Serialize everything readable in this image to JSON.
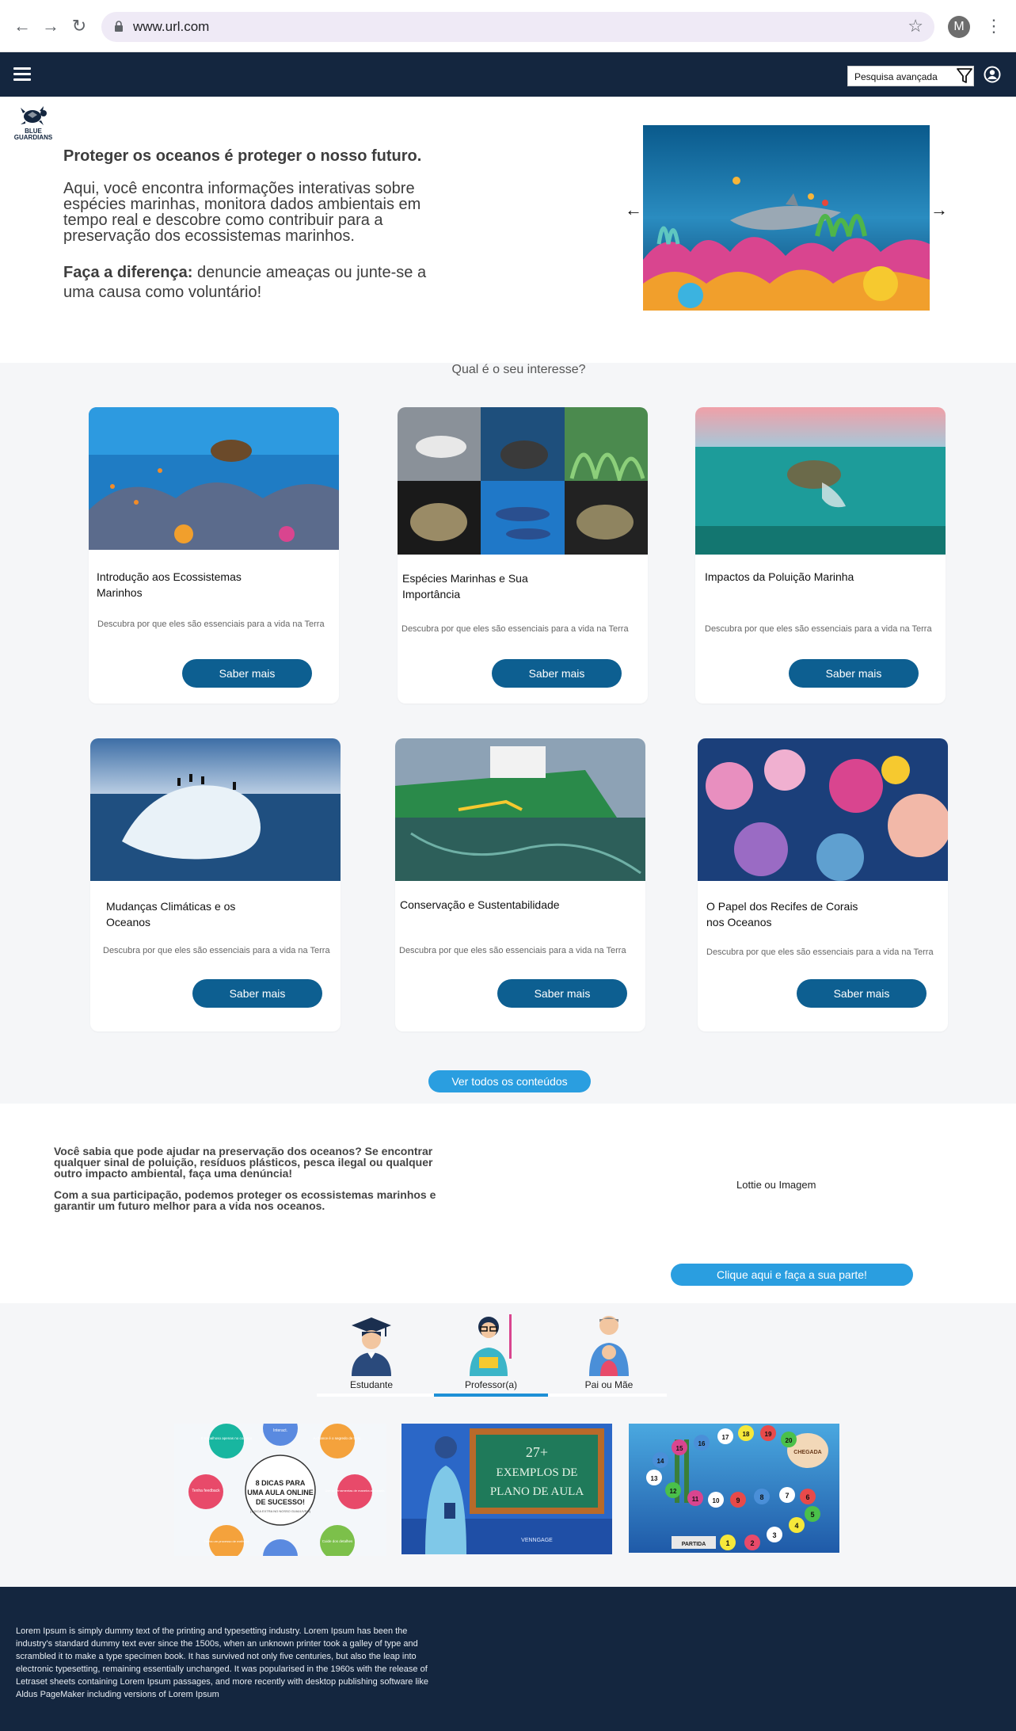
{
  "browser": {
    "url": "www.url.com",
    "avatar_letter": "M"
  },
  "navbar": {
    "search_label": "Pesquisa avançada"
  },
  "hero": {
    "logo_text_1": "BLUE",
    "logo_text_2": "GUARDIANS",
    "title": "Proteger os oceanos é proteger o nosso futuro.",
    "text": "Aqui, você encontra informações interativas sobre espécies marinhas, monitora dados ambientais em tempo real e descobre como contribuir para a preservação dos ecossistemas marinhos.",
    "cta_bold": "Faça a diferença:",
    "cta_text": " denuncie ameaças ou junte-se a uma causa como voluntário!",
    "prev_arrow": "←",
    "next_arrow": "→"
  },
  "interests": {
    "heading": "Qual é o seu interesse?",
    "cards": [
      {
        "title": "Introdução aos Ecossistemas Marinhos",
        "desc": "Descubra por que eles são essenciais para a vida na Terra",
        "button": "Saber mais"
      },
      {
        "title": "Espécies Marinhas e Sua Importância",
        "desc": "Descubra por que eles são essenciais para a vida na Terra",
        "button": "Saber mais"
      },
      {
        "title": "Impactos da Poluição Marinha",
        "desc": "Descubra por que eles são essenciais para a vida na Terra",
        "button": "Saber mais"
      },
      {
        "title": "Mudanças Climáticas e os Oceanos",
        "desc": "Descubra por que eles são essenciais para a vida na Terra",
        "button": "Saber mais"
      },
      {
        "title": "Conservação e Sustentabilidade",
        "desc": "Descubra por que eles são essenciais para a vida na Terra",
        "button": "Saber mais"
      },
      {
        "title": "O Papel dos Recifes de Corais nos Oceanos",
        "desc": "Descubra por que eles são essenciais para a vida na Terra",
        "button": "Saber mais"
      }
    ],
    "see_all": "Ver todos os conteúdos"
  },
  "help": {
    "paragraph_1": "Você sabia que pode ajudar na preservação dos oceanos? Se encontrar qualquer sinal de poluição, resíduos plásticos, pesca ilegal ou qualquer outro impacto ambiental, faça uma denúncia!",
    "paragraph_2": "Com a sua participação, podemos proteger os ecossistemas marinhos e garantir um futuro melhor para a vida nos oceanos.",
    "media_placeholder": "Lottie ou Imagem",
    "button": "Clique aqui e faça a sua parte!"
  },
  "roles": {
    "tabs": [
      {
        "label": "Estudante"
      },
      {
        "label": "Professor(a)"
      },
      {
        "label": "Pai ou Mãe"
      }
    ],
    "active_tab": "Professor(a)",
    "active_color": "#1e90d6"
  },
  "materials": {
    "m1": {
      "center_line1": "8 DICAS PARA",
      "center_line2": "UMA AULA ONLINE",
      "center_line3": "DE SUCESSO!",
      "center_small": "(1 DICA EXTRA NO NOSSO GUIA/LIVRO)",
      "tips": [
        "É trabalhoso apenas no começo",
        "Interact.",
        "A chance é o segredo de tudo.",
        "Use as ferramentas de maneira adequada",
        "Cuide dos detalhes",
        "Tenha um processo de melhoria",
        "Tenha feedback"
      ]
    },
    "m2": {
      "line1": "27+",
      "line2": "EXEMPLOS DE",
      "line3": "PLANO DE AULA",
      "brand": "VENNGAGE"
    },
    "m3": {
      "start_label": "PARTIDA",
      "end_label": "CHEGADA",
      "numbers": [
        "1",
        "2",
        "3",
        "4",
        "5",
        "6",
        "7",
        "8",
        "9",
        "10",
        "11",
        "12",
        "13",
        "14",
        "15",
        "16",
        "17",
        "18",
        "19",
        "20"
      ]
    }
  },
  "footer": {
    "text": "Lorem Ipsum is simply dummy text of the printing and typesetting industry. Lorem Ipsum has been the industry's standard dummy text ever since the 1500s, when an unknown printer took a galley of type and scrambled it to make a type specimen book. It has survived not only five centuries, but also the leap into electronic typesetting, remaining essentially unchanged. It was popularised in the 1960s with the release of Letraset sheets containing Lorem Ipsum passages, and more recently with desktop publishing software like Aldus PageMaker including versions of Lorem Ipsum"
  }
}
